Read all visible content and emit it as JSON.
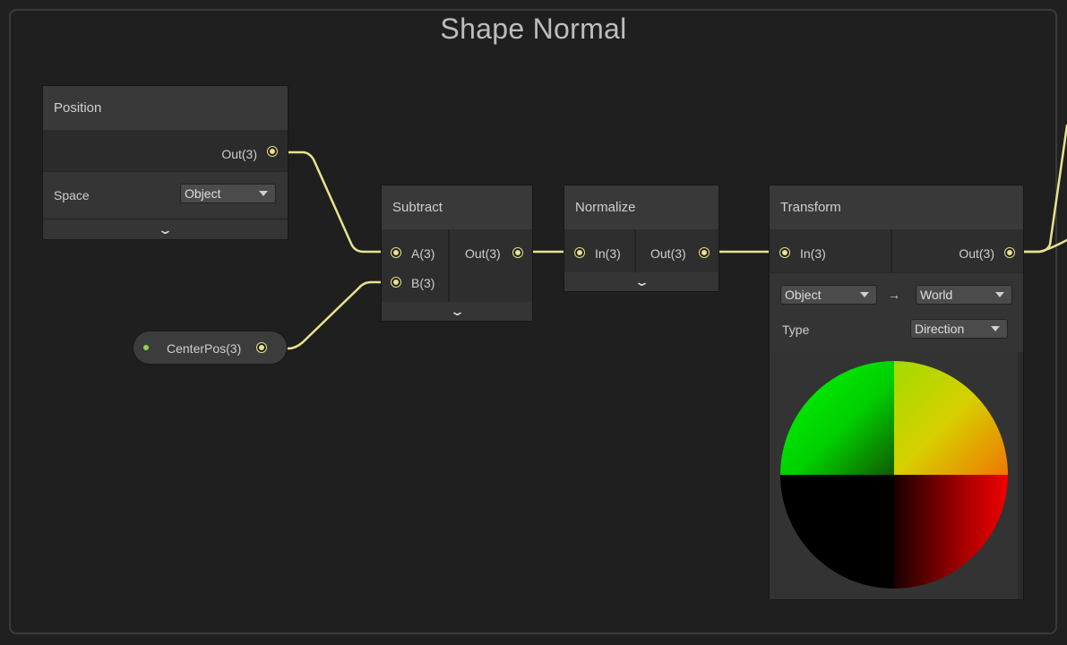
{
  "group": {
    "title": "Shape Normal"
  },
  "wire_color": "#e8e38e",
  "port_color": "#e8e38e",
  "property_dot_color": "#8ed34f",
  "nodes": {
    "position": {
      "title": "Position",
      "out_label": "Out(3)",
      "space_label": "Space",
      "space_value": "Object"
    },
    "subtract": {
      "title": "Subtract",
      "input_a": "A(3)",
      "input_b": "B(3)",
      "out_label": "Out(3)"
    },
    "normalize": {
      "title": "Normalize",
      "in_label": "In(3)",
      "out_label": "Out(3)"
    },
    "transform": {
      "title": "Transform",
      "in_label": "In(3)",
      "out_label": "Out(3)",
      "from_space": "Object",
      "arrow": "→",
      "to_space": "World",
      "type_label": "Type",
      "type_value": "Direction"
    },
    "property": {
      "label": "CenterPos(3)"
    }
  },
  "icons": {
    "expand": "chevron-down-icon",
    "dropdown": "triangle-down-icon",
    "port": "port-dot-icon"
  }
}
